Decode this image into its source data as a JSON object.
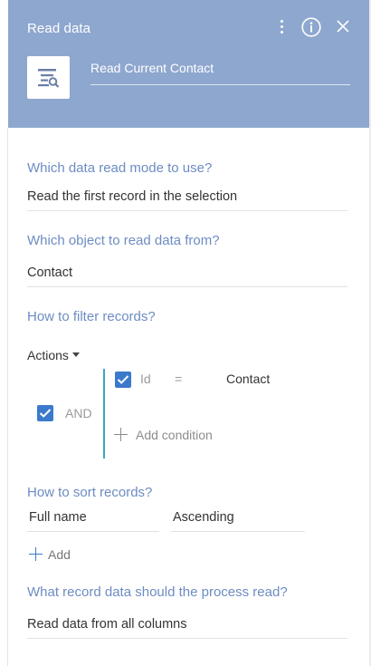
{
  "header": {
    "title": "Read data",
    "element_name": "Read Current Contact",
    "icons": [
      "kebab-menu-icon",
      "info-icon",
      "close-icon",
      "read-data-icon"
    ],
    "background_color": "#8ea7cf"
  },
  "mode": {
    "label": "Which data read mode to use?",
    "value": "Read the first record in the selection"
  },
  "object": {
    "label": "Which object to read data from?",
    "value": "Contact"
  },
  "filter": {
    "label": "How to filter records?",
    "actions_label": "Actions",
    "group_operator": "AND",
    "condition": {
      "column": "Id",
      "operator": "=",
      "value": "Contact"
    },
    "add_condition_label": "Add condition",
    "accent_color": "#3b79cc",
    "group_line_color": "#3aa6c4"
  },
  "sort": {
    "label": "How to sort records?",
    "column": "Full name",
    "direction": "Ascending",
    "add_label": "Add"
  },
  "columns": {
    "label": "What record data should the process read?",
    "value": "Read data from all columns"
  },
  "colors": {
    "label": "#6d8cc3",
    "text": "#333333"
  }
}
